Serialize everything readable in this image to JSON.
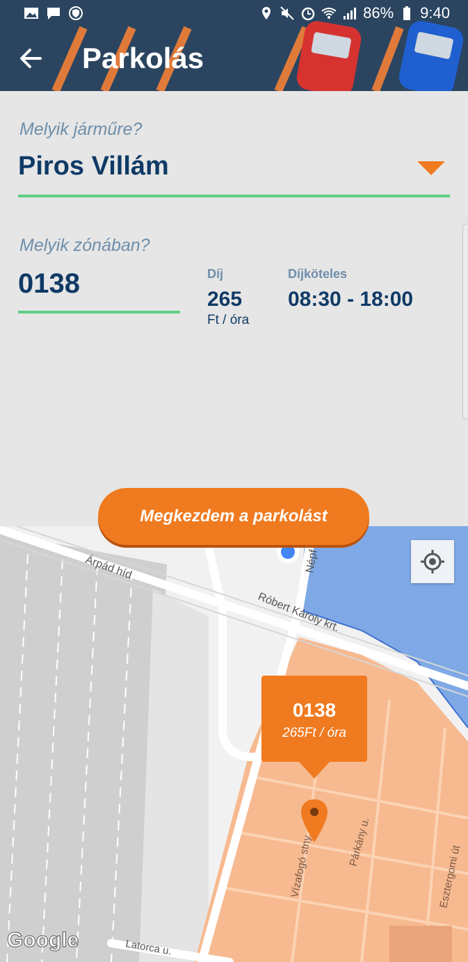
{
  "status_bar": {
    "battery": "86%",
    "time": "9:40"
  },
  "header": {
    "title": "Parkolás"
  },
  "vehicle": {
    "question": "Melyik járműre?",
    "selected": "Piros Villám"
  },
  "zone": {
    "question": "Melyik zónában?",
    "code": "0138",
    "fee_label": "Díj",
    "fee_value": "265",
    "fee_unit": "Ft / óra",
    "hours_label": "Díjköteles",
    "hours_value": "08:30 - 18:00"
  },
  "start_button": "Megkezdem a parkolást",
  "map": {
    "streets": [
      "Árpád híd",
      "Népf",
      "Róbert Károly krt.",
      "Vízafogó stny.",
      "Párkány u.",
      "Esztergomi út",
      "Latorca u."
    ],
    "marker_zone": "0138",
    "marker_price": "265Ft / óra",
    "attribution": "Google"
  },
  "colors": {
    "accent": "#f07a1f",
    "underline": "#5ecf85",
    "primary_text": "#0f3a66",
    "zone_fill": "#f7b98f",
    "blue_zone": "#7fa9e6"
  }
}
